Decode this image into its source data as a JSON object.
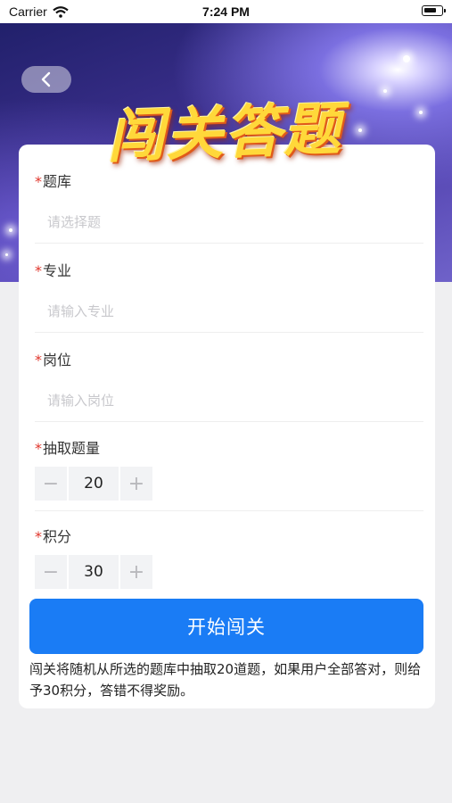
{
  "status_bar": {
    "carrier": "Carrier",
    "time": "7:24 PM"
  },
  "header": {
    "title": "闯关答题",
    "back_icon": "chevron-left-icon"
  },
  "form": {
    "required_mark": "*",
    "question_bank": {
      "label": "题库",
      "placeholder": "请选择题"
    },
    "major": {
      "label": "专业",
      "placeholder": "请输入专业"
    },
    "position": {
      "label": "岗位",
      "placeholder": "请输入岗位"
    },
    "question_count": {
      "label": "抽取题量",
      "value": "20",
      "minus": "−",
      "plus": "+"
    },
    "points": {
      "label": "积分",
      "value": "30",
      "minus": "−",
      "plus": "+"
    }
  },
  "actions": {
    "start_label": "开始闯关"
  },
  "hint": "闯关将随机从所选的题库中抽取20道题，如果用户全部答对，则给予30积分，答错不得奖励。",
  "colors": {
    "accent": "#1a7cf5",
    "required": "#e0352b",
    "banner": "#3b2f8c"
  }
}
